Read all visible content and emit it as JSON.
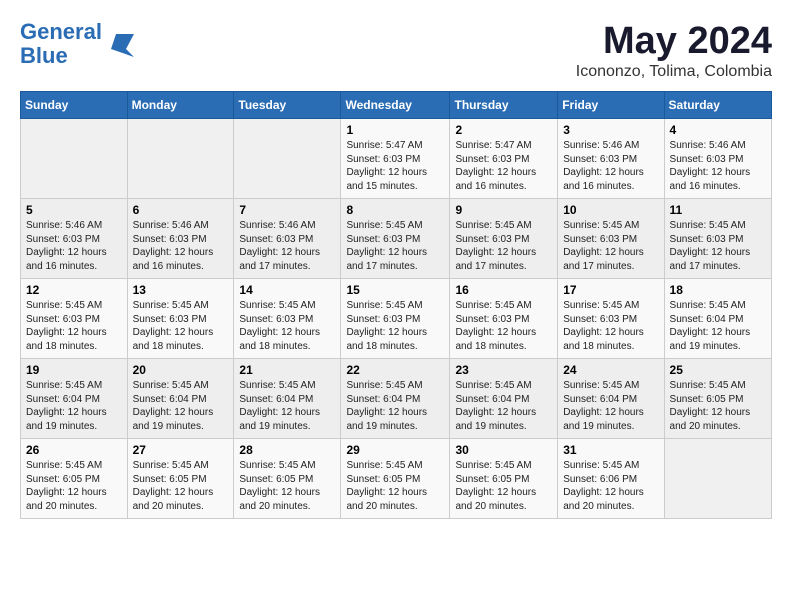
{
  "logo": {
    "line1": "General",
    "line2": "Blue"
  },
  "title": {
    "month": "May 2024",
    "location": "Icononzo, Tolima, Colombia"
  },
  "headers": [
    "Sunday",
    "Monday",
    "Tuesday",
    "Wednesday",
    "Thursday",
    "Friday",
    "Saturday"
  ],
  "weeks": [
    [
      {
        "day": "",
        "info": ""
      },
      {
        "day": "",
        "info": ""
      },
      {
        "day": "",
        "info": ""
      },
      {
        "day": "1",
        "info": "Sunrise: 5:47 AM\nSunset: 6:03 PM\nDaylight: 12 hours\nand 15 minutes."
      },
      {
        "day": "2",
        "info": "Sunrise: 5:47 AM\nSunset: 6:03 PM\nDaylight: 12 hours\nand 16 minutes."
      },
      {
        "day": "3",
        "info": "Sunrise: 5:46 AM\nSunset: 6:03 PM\nDaylight: 12 hours\nand 16 minutes."
      },
      {
        "day": "4",
        "info": "Sunrise: 5:46 AM\nSunset: 6:03 PM\nDaylight: 12 hours\nand 16 minutes."
      }
    ],
    [
      {
        "day": "5",
        "info": "Sunrise: 5:46 AM\nSunset: 6:03 PM\nDaylight: 12 hours\nand 16 minutes."
      },
      {
        "day": "6",
        "info": "Sunrise: 5:46 AM\nSunset: 6:03 PM\nDaylight: 12 hours\nand 16 minutes."
      },
      {
        "day": "7",
        "info": "Sunrise: 5:46 AM\nSunset: 6:03 PM\nDaylight: 12 hours\nand 17 minutes."
      },
      {
        "day": "8",
        "info": "Sunrise: 5:45 AM\nSunset: 6:03 PM\nDaylight: 12 hours\nand 17 minutes."
      },
      {
        "day": "9",
        "info": "Sunrise: 5:45 AM\nSunset: 6:03 PM\nDaylight: 12 hours\nand 17 minutes."
      },
      {
        "day": "10",
        "info": "Sunrise: 5:45 AM\nSunset: 6:03 PM\nDaylight: 12 hours\nand 17 minutes."
      },
      {
        "day": "11",
        "info": "Sunrise: 5:45 AM\nSunset: 6:03 PM\nDaylight: 12 hours\nand 17 minutes."
      }
    ],
    [
      {
        "day": "12",
        "info": "Sunrise: 5:45 AM\nSunset: 6:03 PM\nDaylight: 12 hours\nand 18 minutes."
      },
      {
        "day": "13",
        "info": "Sunrise: 5:45 AM\nSunset: 6:03 PM\nDaylight: 12 hours\nand 18 minutes."
      },
      {
        "day": "14",
        "info": "Sunrise: 5:45 AM\nSunset: 6:03 PM\nDaylight: 12 hours\nand 18 minutes."
      },
      {
        "day": "15",
        "info": "Sunrise: 5:45 AM\nSunset: 6:03 PM\nDaylight: 12 hours\nand 18 minutes."
      },
      {
        "day": "16",
        "info": "Sunrise: 5:45 AM\nSunset: 6:03 PM\nDaylight: 12 hours\nand 18 minutes."
      },
      {
        "day": "17",
        "info": "Sunrise: 5:45 AM\nSunset: 6:03 PM\nDaylight: 12 hours\nand 18 minutes."
      },
      {
        "day": "18",
        "info": "Sunrise: 5:45 AM\nSunset: 6:04 PM\nDaylight: 12 hours\nand 19 minutes."
      }
    ],
    [
      {
        "day": "19",
        "info": "Sunrise: 5:45 AM\nSunset: 6:04 PM\nDaylight: 12 hours\nand 19 minutes."
      },
      {
        "day": "20",
        "info": "Sunrise: 5:45 AM\nSunset: 6:04 PM\nDaylight: 12 hours\nand 19 minutes."
      },
      {
        "day": "21",
        "info": "Sunrise: 5:45 AM\nSunset: 6:04 PM\nDaylight: 12 hours\nand 19 minutes."
      },
      {
        "day": "22",
        "info": "Sunrise: 5:45 AM\nSunset: 6:04 PM\nDaylight: 12 hours\nand 19 minutes."
      },
      {
        "day": "23",
        "info": "Sunrise: 5:45 AM\nSunset: 6:04 PM\nDaylight: 12 hours\nand 19 minutes."
      },
      {
        "day": "24",
        "info": "Sunrise: 5:45 AM\nSunset: 6:04 PM\nDaylight: 12 hours\nand 19 minutes."
      },
      {
        "day": "25",
        "info": "Sunrise: 5:45 AM\nSunset: 6:05 PM\nDaylight: 12 hours\nand 20 minutes."
      }
    ],
    [
      {
        "day": "26",
        "info": "Sunrise: 5:45 AM\nSunset: 6:05 PM\nDaylight: 12 hours\nand 20 minutes."
      },
      {
        "day": "27",
        "info": "Sunrise: 5:45 AM\nSunset: 6:05 PM\nDaylight: 12 hours\nand 20 minutes."
      },
      {
        "day": "28",
        "info": "Sunrise: 5:45 AM\nSunset: 6:05 PM\nDaylight: 12 hours\nand 20 minutes."
      },
      {
        "day": "29",
        "info": "Sunrise: 5:45 AM\nSunset: 6:05 PM\nDaylight: 12 hours\nand 20 minutes."
      },
      {
        "day": "30",
        "info": "Sunrise: 5:45 AM\nSunset: 6:05 PM\nDaylight: 12 hours\nand 20 minutes."
      },
      {
        "day": "31",
        "info": "Sunrise: 5:45 AM\nSunset: 6:06 PM\nDaylight: 12 hours\nand 20 minutes."
      },
      {
        "day": "",
        "info": ""
      }
    ]
  ]
}
